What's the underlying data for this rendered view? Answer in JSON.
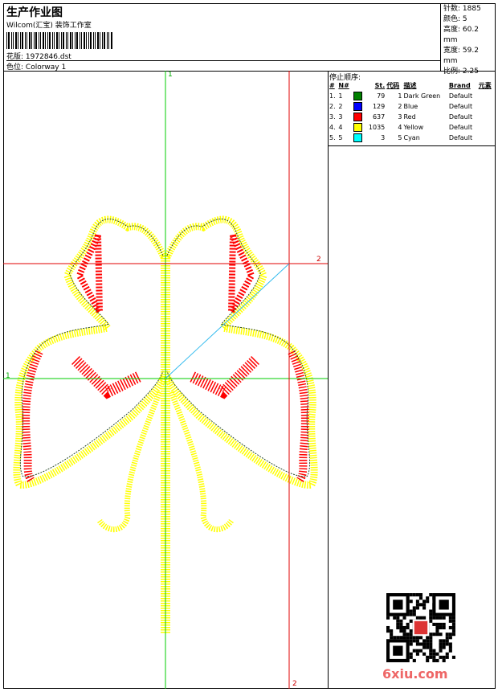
{
  "header": {
    "title": "生产作业图",
    "vendor": "Wilcom(汇宝) 装饰工作室",
    "file_label": "花版:",
    "file_name": "1972846.dst",
    "colorway_label": "色位:",
    "colorway": "Colorway 1"
  },
  "stats": {
    "stitches_label": "针数:",
    "stitches": "1885",
    "colors_label": "颜色:",
    "colors": "5",
    "height_label": "高度:",
    "height": "60.2 mm",
    "width_label": "宽度:",
    "width": "59.2 mm",
    "ratio_label": "比例:",
    "ratio": "2.25"
  },
  "stop_sequence": {
    "title": "停止顺序:",
    "columns": [
      "#",
      "N#",
      "",
      "St.",
      "代码",
      "描述",
      "Brand",
      "元素"
    ],
    "rows": [
      {
        "num": "1.",
        "n": "1",
        "color": "#008000",
        "st": "79",
        "code": "1",
        "desc": "Dark Green",
        "brand": "Default"
      },
      {
        "num": "2.",
        "n": "2",
        "color": "#0000ff",
        "st": "129",
        "code": "2",
        "desc": "Blue",
        "brand": "Default"
      },
      {
        "num": "3.",
        "n": "3",
        "color": "#ff0000",
        "st": "637",
        "code": "3",
        "desc": "Red",
        "brand": "Default"
      },
      {
        "num": "4.",
        "n": "4",
        "color": "#ffff00",
        "st": "1035",
        "code": "4",
        "desc": "Yellow",
        "brand": "Default"
      },
      {
        "num": "5.",
        "n": "5",
        "color": "#00ffff",
        "st": "3",
        "code": "5",
        "desc": "Cyan",
        "brand": "Default"
      }
    ]
  },
  "axes": {
    "v1": "1",
    "h1": "1",
    "h2": "2",
    "v2": "2",
    "green": "#00cc00",
    "red": "#e00000",
    "cyan": "#33bbee"
  },
  "watermark": "6xiu.com"
}
